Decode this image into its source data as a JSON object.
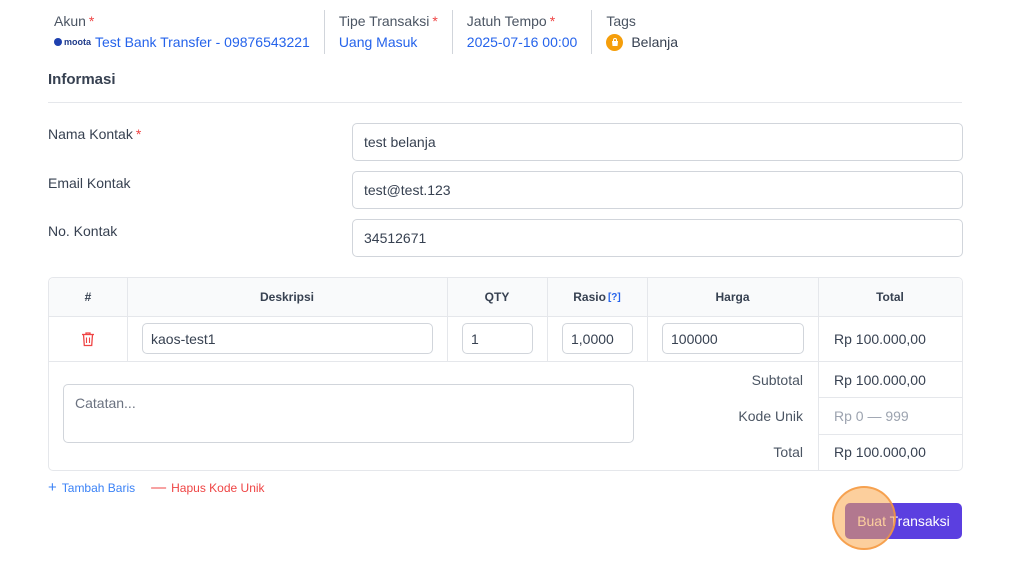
{
  "header": {
    "account": {
      "label": "Akun",
      "brand": "moota",
      "value": "Test Bank Transfer - 09876543221"
    },
    "transaction_type": {
      "label": "Tipe Transaksi",
      "value": "Uang Masuk"
    },
    "due_date": {
      "label": "Jatuh Tempo",
      "value": "2025-07-16 00:00"
    },
    "tags": {
      "label": "Tags",
      "value": "Belanja",
      "icon": "shopping-bag-icon",
      "color": "#f59e0b"
    },
    "required_mark": "*"
  },
  "info": {
    "title": "Informasi",
    "contact_name": {
      "label": "Nama Kontak",
      "value": "test belanja"
    },
    "contact_email": {
      "label": "Email Kontak",
      "value": "test@test.123"
    },
    "contact_phone": {
      "label": "No. Kontak",
      "value": "34512671"
    }
  },
  "table": {
    "headers": {
      "index": "#",
      "description": "Deskripsi",
      "qty": "QTY",
      "ratio": "Rasio",
      "ratio_help": "[?]",
      "price": "Harga",
      "total": "Total"
    },
    "rows": [
      {
        "description": "kaos-test1",
        "qty": "1",
        "ratio": "1,0000",
        "price": "100000",
        "total": "Rp 100.000,00"
      }
    ],
    "notes_placeholder": "Catatan...",
    "summary": {
      "subtotal_label": "Subtotal",
      "subtotal_value": "Rp 100.000,00",
      "unique_code_label": "Kode Unik",
      "unique_code_placeholder": "Rp 0 — 999",
      "total_label": "Total",
      "total_value": "Rp 100.000,00"
    }
  },
  "actions": {
    "add_row": "Tambah Baris",
    "remove_unique_code": "Hapus Kode Unik",
    "submit": "Buat Transaksi"
  },
  "colors": {
    "accent": "#2563eb",
    "button": "#5b3fe0",
    "danger": "#ef4444",
    "cursor_highlight": "#f9a84c"
  }
}
